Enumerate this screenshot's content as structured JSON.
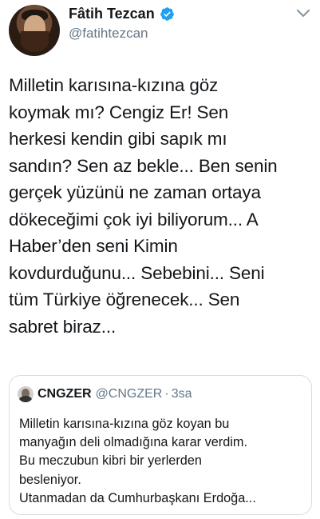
{
  "tweet": {
    "author_name": "Fâtih Tezcan",
    "author_handle": "@fatihtezcan",
    "text_lines": [
      "Milletin karısına-kızına göz",
      "koymak mı? Cengiz Er! Sen",
      "herkesi kendin gibi sapık mı",
      "sandın? Sen az bekle... Ben senin",
      "gerçek yüzünü ne zaman ortaya",
      "dökeceğimi çok iyi biliyorum... A",
      "Haber’den seni Kimin",
      "kovdurduğunu... Sebebini... Seni",
      "tüm Türkiye öğrenecek... Sen",
      "sabret biraz..."
    ],
    "icons": {
      "verified": "verified-badge-icon",
      "menu": "chevron-down-icon"
    }
  },
  "quoted_tweet": {
    "author_name": "CNGZER",
    "author_handle": "@CNGZER",
    "separator": "·",
    "time": "3sa",
    "text_lines": [
      "Milletin karısına-kızına göz koyan bu",
      "manyağın deli olmadığına karar verdim.",
      "Bu meczubun kibri bir yerlerden",
      "besleniyor.",
      "Utanmadan da Cumhurbaşkanı Erdoğa..."
    ]
  },
  "colors": {
    "accent": "#1da1f2",
    "text_primary": "#14171a",
    "text_secondary": "#657786",
    "border": "#d8dde2"
  }
}
